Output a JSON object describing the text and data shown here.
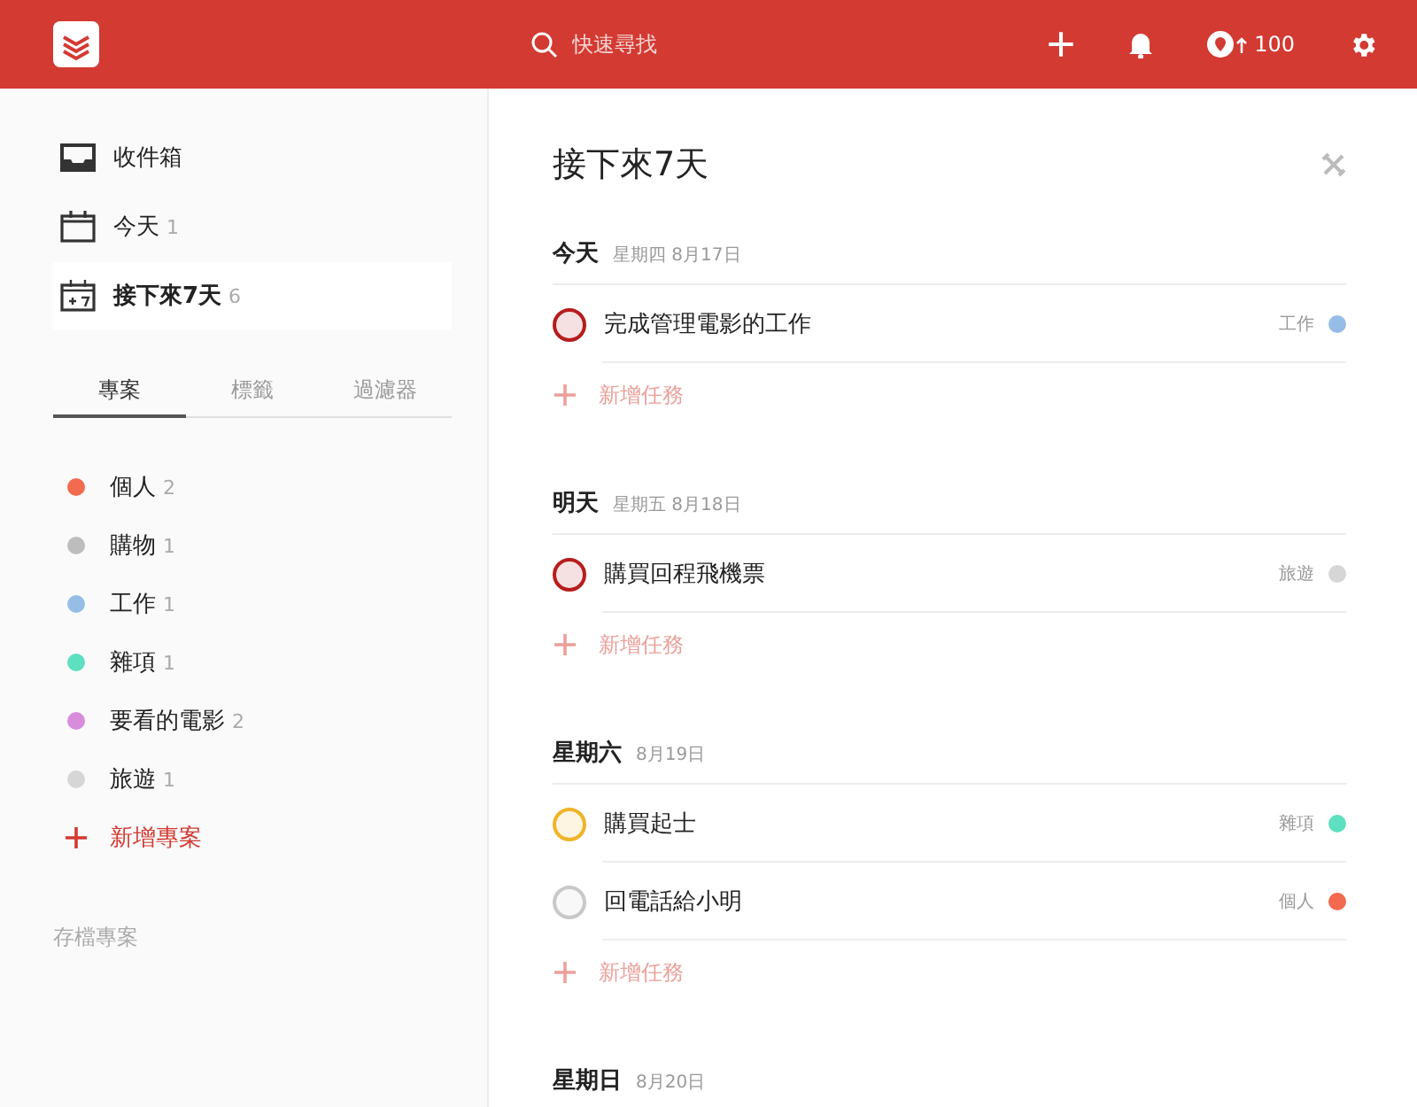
{
  "header": {
    "search": {
      "placeholder": "快速尋找"
    },
    "karma": "100"
  },
  "sidebar": {
    "filters": [
      {
        "kind": "inbox",
        "label": "收件箱",
        "selected": false
      },
      {
        "kind": "today",
        "label": "今天",
        "count": "1",
        "selected": false
      },
      {
        "kind": "week",
        "label": "接下來7天",
        "count": "6",
        "selected": true
      }
    ],
    "tabs": [
      {
        "label": "專案",
        "selected": true
      },
      {
        "label": "標籤",
        "selected": false
      },
      {
        "label": "過濾器",
        "selected": false
      }
    ],
    "projects": [
      {
        "name": "個人",
        "count": "2",
        "color": "#f26a50"
      },
      {
        "name": "購物",
        "count": "1",
        "color": "#bdbdbd"
      },
      {
        "name": "工作",
        "count": "1",
        "color": "#96bde6"
      },
      {
        "name": "雜項",
        "count": "1",
        "color": "#5ee0c0"
      },
      {
        "name": "要看的電影",
        "count": "2",
        "color": "#d98cdb"
      },
      {
        "name": "旅遊",
        "count": "1",
        "color": "#d6d6d6"
      }
    ],
    "add_project": "新增專案",
    "archive": "存檔專案"
  },
  "main": {
    "title": "接下來7天",
    "days": [
      {
        "day": "今天",
        "date": "星期四 8月17日",
        "tasks": [
          {
            "text": "完成管理電影的工作",
            "color": "#b71c1c",
            "project": {
              "name": "工作",
              "color": "#96bde6"
            }
          }
        ],
        "add_task": "新增任務"
      },
      {
        "day": "明天",
        "date": "星期五 8月18日",
        "tasks": [
          {
            "text": "購買回程飛機票",
            "color": "#b71c1c",
            "project": {
              "name": "旅遊",
              "color": "#d6d6d6"
            }
          }
        ],
        "add_task": "新增任務"
      },
      {
        "day": "星期六",
        "date": "8月19日",
        "tasks": [
          {
            "text": "購買起士",
            "color": "#f0b429",
            "project": {
              "name": "雜項",
              "color": "#5ee0c0"
            }
          },
          {
            "text": "回電話給小明",
            "color": "#c8c8c8",
            "project": {
              "name": "個人",
              "color": "#f26a50"
            }
          }
        ],
        "add_task": "新增任務"
      },
      {
        "day": "星期日",
        "date": "8月20日"
      }
    ]
  }
}
